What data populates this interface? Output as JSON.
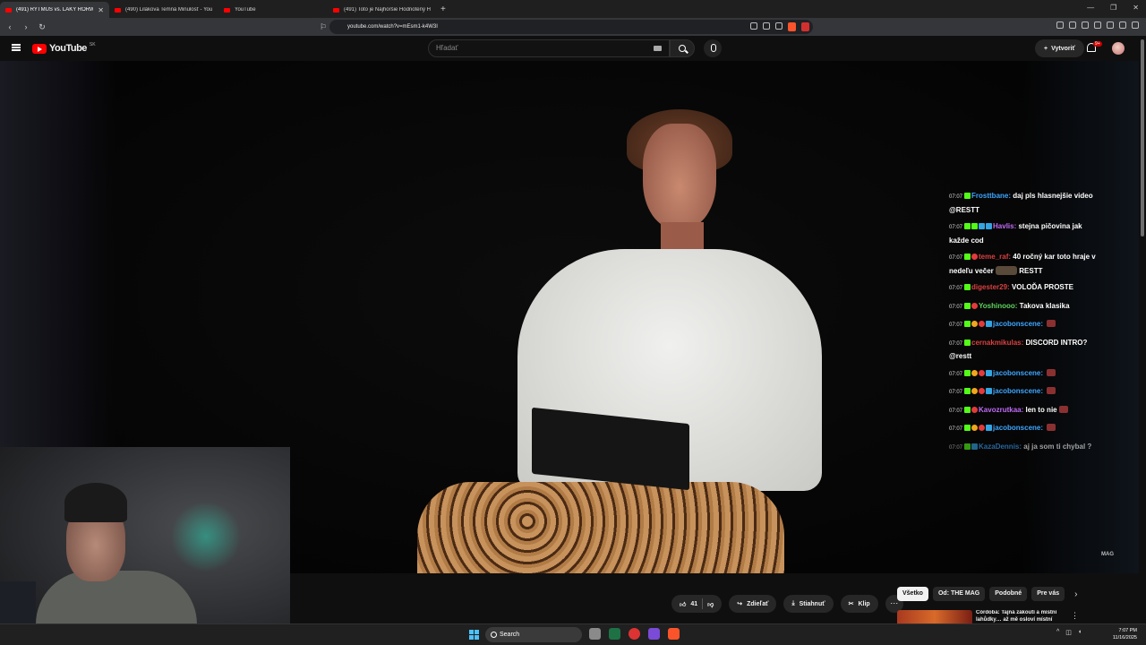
{
  "browser": {
    "tabs": [
      {
        "title": "(491) RYTMUS vs. LAKY RORW",
        "active": true
      },
      {
        "title": "(490) Lilákova Temná Minulosť - You",
        "active": false
      },
      {
        "title": "YouTube",
        "active": false
      },
      {
        "title": "(491) Toto je Najhoršie Hodnotený H",
        "active": false
      }
    ],
    "new_tab": "+",
    "url": "youtube.com/watch?v=mEsm1-k4W3I",
    "ext_badge": "9"
  },
  "youtube": {
    "logo_text": "YouTube",
    "country_code": "SK",
    "search_placeholder": "Hľadať",
    "create_label": "Vytvoriť",
    "notif_badge": "9+"
  },
  "video": {
    "watermark": "MAG",
    "chat": [
      {
        "time": "07:07",
        "badges": [
          "g"
        ],
        "user": "Frosttbane:",
        "user_color": "#3ea6ff",
        "text": "daj pls hlasnejšie video @RESTT"
      },
      {
        "time": "07:07",
        "badges": [
          "g",
          "g",
          "b",
          "b"
        ],
        "user": "Havlis:",
        "user_color": "#c06cf6",
        "text": "stejna pičovina jak každe cod"
      },
      {
        "time": "07:07",
        "badges": [
          "g",
          "r"
        ],
        "user": "teme_raf:",
        "user_color": "#d94040",
        "text": "40 ročný kar toto hraje v nedeľu večer",
        "emote": true,
        "tail": "RESTT"
      },
      {
        "time": "07:07",
        "badges": [
          "g"
        ],
        "user": "digester29:",
        "user_color": "#d94040",
        "text": "VOLOĎA PROSTE"
      },
      {
        "time": "07:07",
        "badges": [
          "g",
          "r"
        ],
        "user": "Yoshinooo:",
        "user_color": "#5fd35f",
        "text": "Takova klasika"
      },
      {
        "time": "07:07",
        "badges": [
          "g",
          "o",
          "r",
          "b"
        ],
        "user": "jacobonscene:",
        "user_color": "#3ea6ff",
        "text": ""
      },
      {
        "time": "07:07",
        "badges": [
          "g"
        ],
        "user": "cernakmikulas:",
        "user_color": "#d94040",
        "text": "DISCORD INTRO? @restt"
      },
      {
        "time": "07:07",
        "badges": [
          "g",
          "o",
          "r",
          "b"
        ],
        "user": "jacobonscene:",
        "user_color": "#3ea6ff",
        "text": ""
      },
      {
        "time": "07:07",
        "badges": [
          "g",
          "o",
          "r",
          "b"
        ],
        "user": "jacobonscene:",
        "user_color": "#3ea6ff",
        "text": ""
      },
      {
        "time": "07:07",
        "badges": [
          "g",
          "r"
        ],
        "user": "Kavozrutkaa:",
        "user_color": "#c06cf6",
        "text": "len to nie"
      },
      {
        "time": "07:07",
        "badges": [
          "g",
          "o",
          "r",
          "b"
        ],
        "user": "jacobonscene:",
        "user_color": "#3ea6ff",
        "text": ""
      },
      {
        "time": "07:07",
        "badges": [
          "g",
          "b"
        ],
        "user": "KazaDennis:",
        "user_color": "#3ea6ff",
        "text": "aj ja som ti chybal ?",
        "faded": true
      }
    ]
  },
  "actions": {
    "likes": "41",
    "share": "Zdieľať",
    "download": "Stiahnuť",
    "clip": "Klip",
    "more": "⋯"
  },
  "chips": [
    "Všetko",
    "Od: THE MAG",
    "Podobné",
    "Pre vás"
  ],
  "recommendation": {
    "title": "Córdoba: Tajná zákoutí a místní lahůdky… až mě osloví místní"
  },
  "taskbar": {
    "search": "Search",
    "time": "7:07 PM",
    "date": "11/16/2025"
  }
}
